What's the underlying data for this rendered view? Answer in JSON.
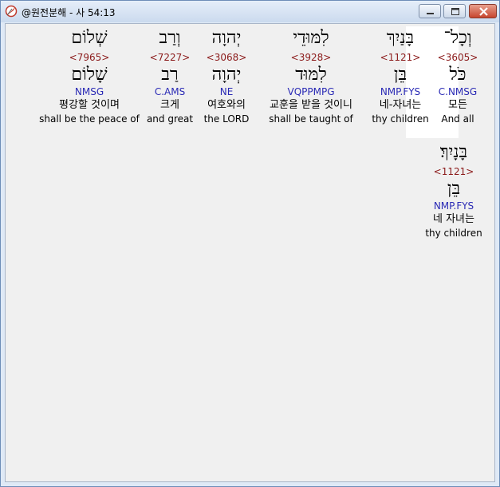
{
  "window": {
    "title": "@원전분해 - 사 54:13",
    "icon": "compass-icon"
  },
  "words": [
    {
      "hebrew": "וְכָל־",
      "strong": "<3605>",
      "lemma": "כֹּל",
      "morph": "C.NMSG",
      "korean": "모든",
      "english": "And all",
      "selected": true
    },
    {
      "hebrew": "בָּנַיִךְ",
      "strong": "<1121>",
      "lemma": "בֵּן",
      "morph": "NMP.FYS",
      "korean": "네-자녀는",
      "english": "thy children",
      "selected": false
    },
    {
      "hebrew": "לִמּוּדֵי",
      "strong": "<3928>",
      "lemma": "לִמּוּד",
      "morph": "VQPPMPG",
      "korean": "교훈을 받을 것이니",
      "english": "shall be taught of",
      "selected": false
    },
    {
      "hebrew": "יְהוָה",
      "strong": "<3068>",
      "lemma": "יְהוָה",
      "morph": "NE",
      "korean": "여호와의",
      "english": "the LORD",
      "selected": false
    },
    {
      "hebrew": "וְרַב",
      "strong": "<7227>",
      "lemma": "רַב",
      "morph": "C.AMS",
      "korean": "크게",
      "english": "and great",
      "selected": false
    },
    {
      "hebrew": "שְׁלוֹם",
      "strong": "<7965>",
      "lemma": "שָׁלוֹם",
      "morph": "NMSG",
      "korean": "평강할 것이며",
      "english": "shall be the peace of",
      "selected": false
    },
    {
      "hebrew": "בָּנָיִךְ׃",
      "strong": "<1121>",
      "lemma": "בֵּן",
      "morph": "NMP.FYS",
      "korean": "네 자녀는",
      "english": "thy children",
      "selected": false
    }
  ]
}
